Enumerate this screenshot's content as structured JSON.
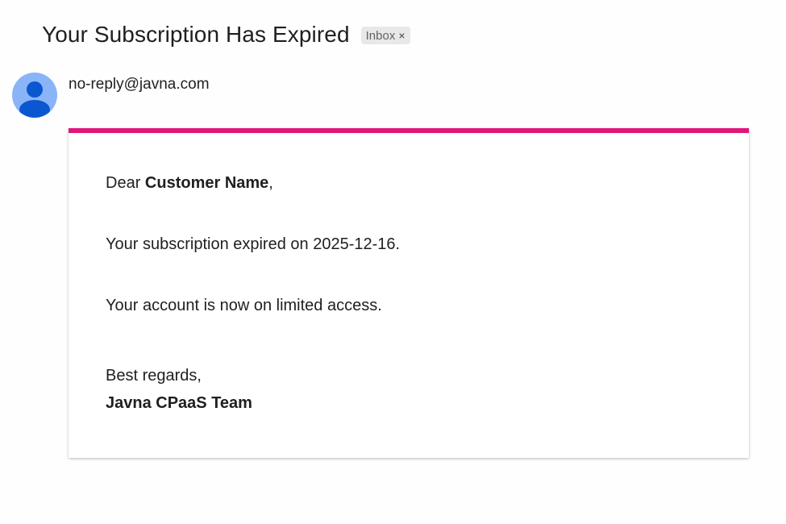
{
  "email": {
    "subject": "Your Subscription Has Expired",
    "label": "Inbox",
    "label_close": "×",
    "sender": "no-reply@javna.com"
  },
  "message": {
    "greeting_prefix": "Dear ",
    "customer_name": "Customer Name",
    "greeting_suffix": ",",
    "line_expired": "Your subscription expired on 2025-12-16.",
    "line_access": "Your account is now on limited access.",
    "closing": "Best regards,",
    "signature": "Javna CPaaS Team"
  },
  "colors": {
    "accent": "#e0177a",
    "avatar_bg": "#8ab4f8",
    "avatar_fg": "#0b57d0"
  },
  "icons": {
    "avatar": "person-icon",
    "label_close": "close-icon"
  }
}
